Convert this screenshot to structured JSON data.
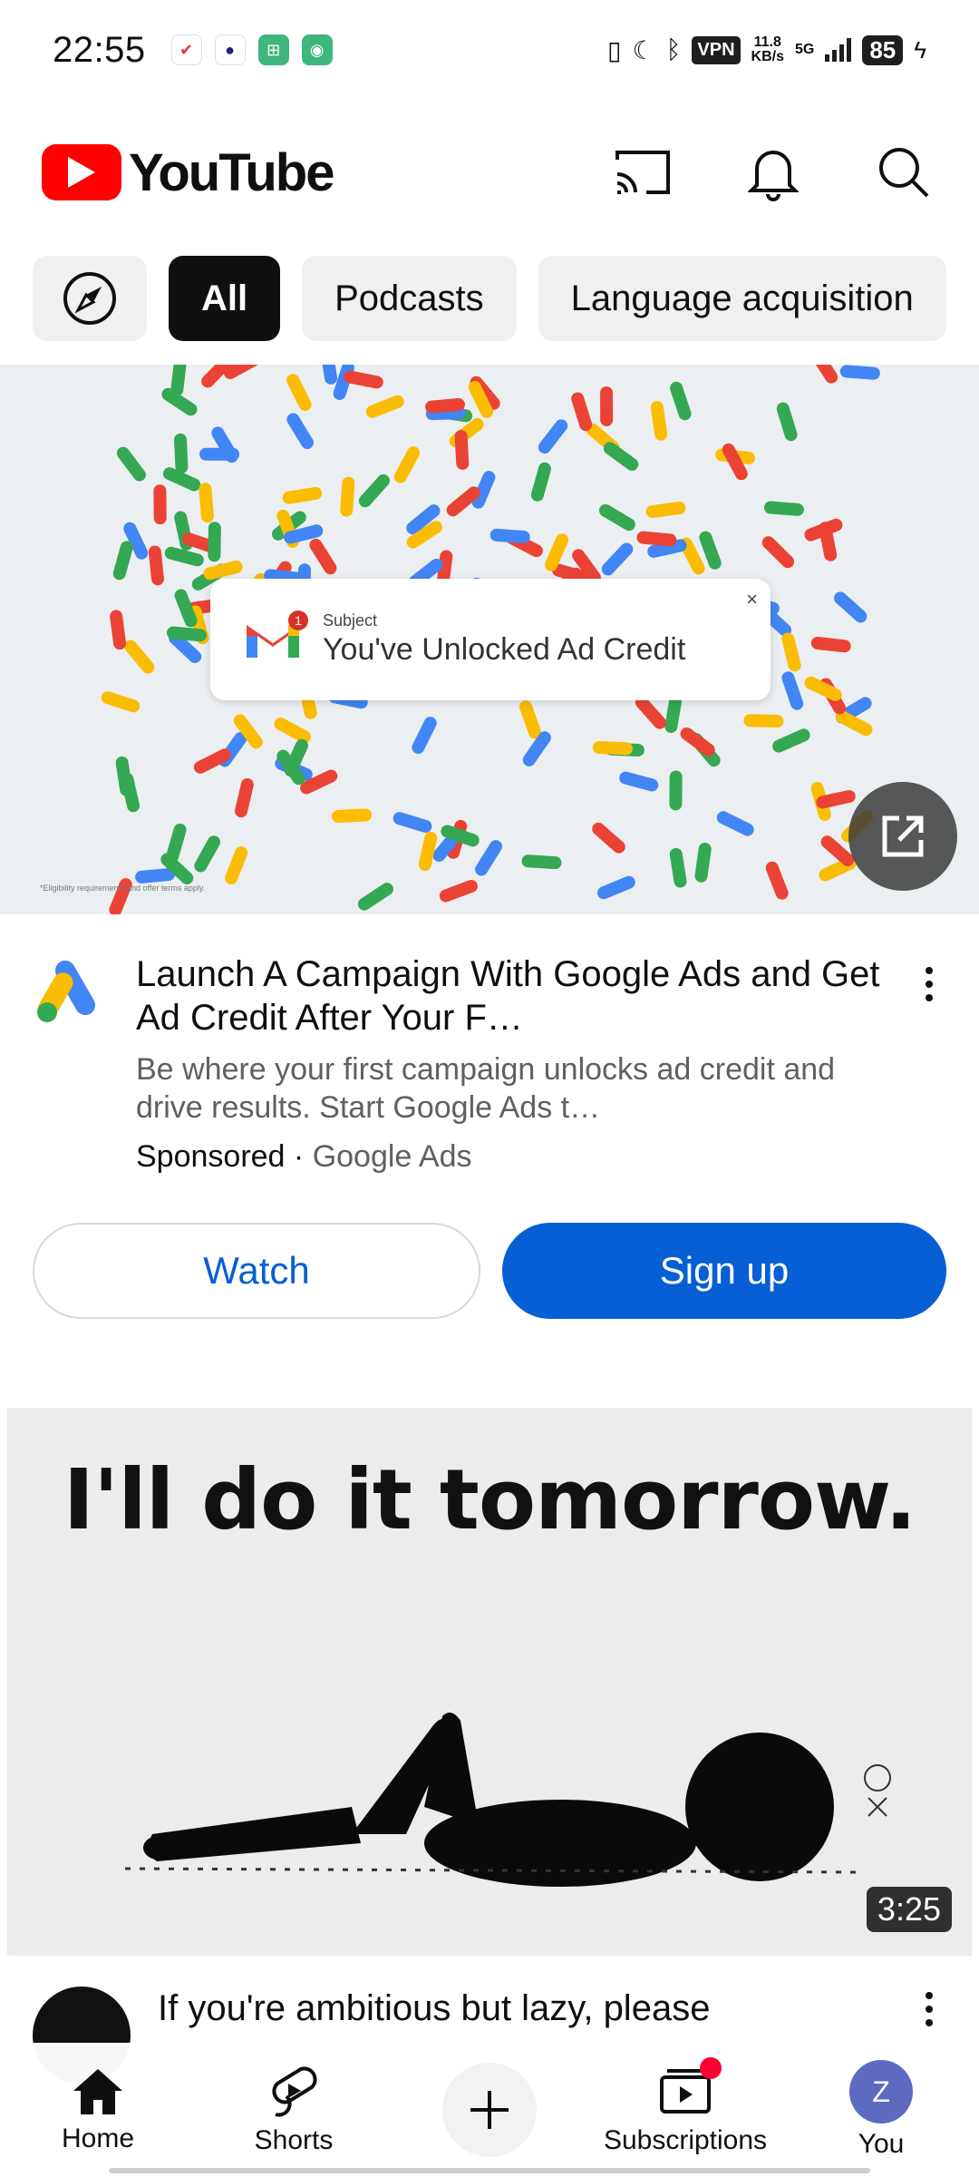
{
  "status_bar": {
    "time": "22:55",
    "vpn": "VPN",
    "speed_value": "11.8",
    "speed_unit": "KB/s",
    "network": "5G",
    "battery": "85"
  },
  "header": {
    "logo_text": "YouTube",
    "icons": [
      "cast-icon",
      "notifications-icon",
      "search-icon"
    ]
  },
  "chips": [
    {
      "label": "All",
      "active": true
    },
    {
      "label": "Podcasts",
      "active": false
    },
    {
      "label": "Language acquisition",
      "active": false
    }
  ],
  "ad": {
    "banner": {
      "subject_label": "Subject",
      "subject_text": "You've Unlocked Ad Credit",
      "close": "×",
      "eligibility": "*Eligibility requirements and offer terms apply.",
      "badge_count": "1"
    },
    "title": "Launch A Campaign With Google Ads and Get Ad Credit After Your F…",
    "description": "Be where your first campaign unlocks ad credit and drive results. Start Google Ads t…",
    "sponsored": "Sponsored",
    "separator": " · ",
    "advertiser": "Google Ads",
    "watch_label": "Watch",
    "signup_label": "Sign up"
  },
  "video": {
    "thumbnail_caption": "I'll do it tomorrow.",
    "duration": "3:25",
    "title": "If you're ambitious but lazy, please"
  },
  "bottom_nav": {
    "home": "Home",
    "shorts": "Shorts",
    "subscriptions": "Subscriptions",
    "you": "You",
    "you_initial": "Z"
  },
  "colors": {
    "brand_red": "#ff0000",
    "link_blue": "#065fd4",
    "chip_bg": "#f0f0f0"
  }
}
